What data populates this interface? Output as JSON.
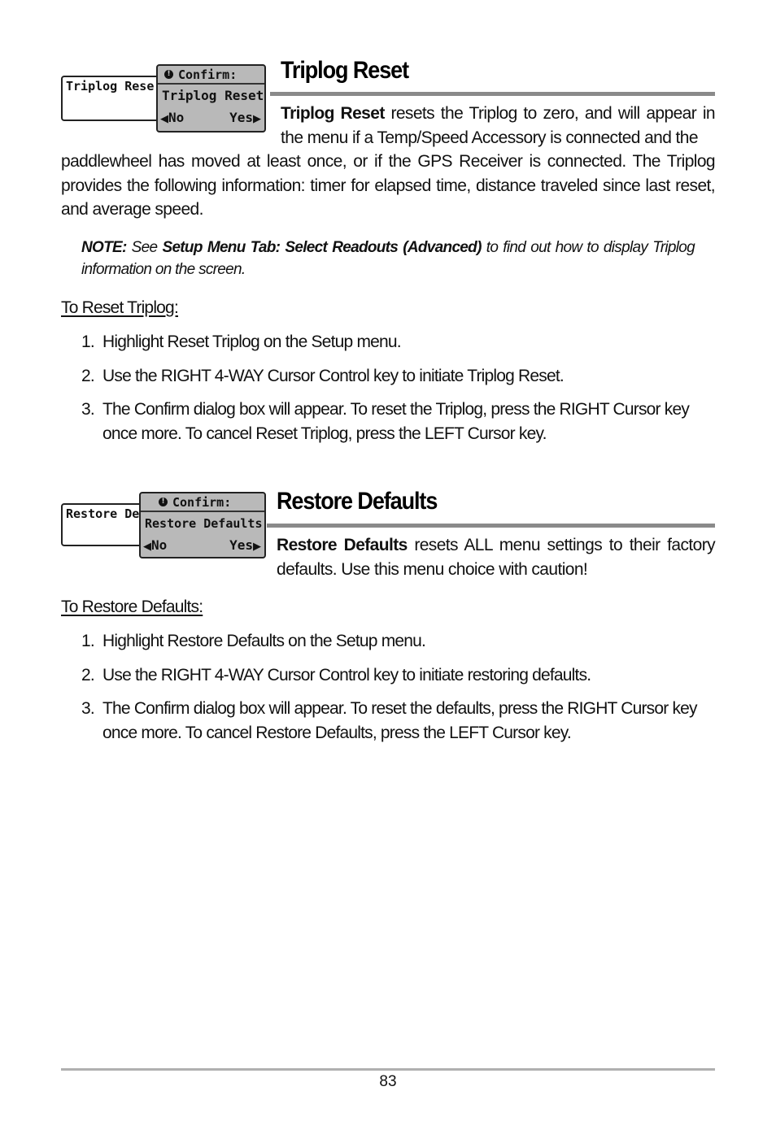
{
  "sections": [
    {
      "title": "Triplog Reset",
      "screen": {
        "menu_item_text": "Triplog Rese",
        "dialog_title": "Confirm:",
        "dialog_item": "Triplog Reset",
        "option_no": "No",
        "option_yes": "Yes"
      },
      "intro_bold": "Triplog Reset",
      "intro_text": " resets the Triplog to zero, and will appear in the menu if a Temp/Speed Accessory is connected and the",
      "intro_continued": "paddlewheel has moved at least once, or if the GPS Receiver is connected. The Triplog provides the following information: timer for elapsed time, distance traveled since last reset, and average speed.",
      "note": {
        "label": "NOTE:",
        "pre": "  See ",
        "ref": "Setup Menu Tab: Select Readouts (Advanced)",
        "post": " to find out how to display Triplog information on the screen."
      },
      "procedure_title": "To Reset Triplog:",
      "steps": [
        {
          "num": "1.",
          "text": "Highlight Reset Triplog on the Setup menu."
        },
        {
          "num": "2.",
          "text": "Use the RIGHT 4-WAY Cursor Control key to initiate Triplog Reset."
        },
        {
          "num": "3.",
          "text": "The Confirm dialog box will appear. To reset the Triplog, press the RIGHT Cursor key once more. To cancel Reset Triplog, press the LEFT Cursor key."
        }
      ]
    },
    {
      "title": "Restore Defaults",
      "screen": {
        "menu_item_text": "Restore De",
        "dialog_title": "Confirm:",
        "dialog_item": "Restore Defaults",
        "option_no": "No",
        "option_yes": "Yes"
      },
      "intro_bold": "Restore Defaults",
      "intro_text": " resets ALL menu settings to their factory defaults. Use this menu choice with caution!",
      "procedure_title": "To Restore Defaults:",
      "steps": [
        {
          "num": "1.",
          "text": "Highlight Restore Defaults on the Setup menu."
        },
        {
          "num": "2.",
          "text": "Use the RIGHT 4-WAY Cursor Control key to initiate restoring defaults."
        },
        {
          "num": "3.",
          "text": "The Confirm dialog box will appear. To reset the defaults,  press the RIGHT Cursor key once more. To cancel Restore Defaults, press the LEFT Cursor key."
        }
      ]
    }
  ],
  "icons": {
    "alert": "!",
    "arrow_left": "◀",
    "arrow_right": "▶"
  },
  "colors": {
    "heading_rule": "#8a8a8a",
    "dialog_background": "#b9b9b9",
    "footer_rule": "#b0b0b0"
  },
  "footer": {
    "page_number": "83"
  }
}
